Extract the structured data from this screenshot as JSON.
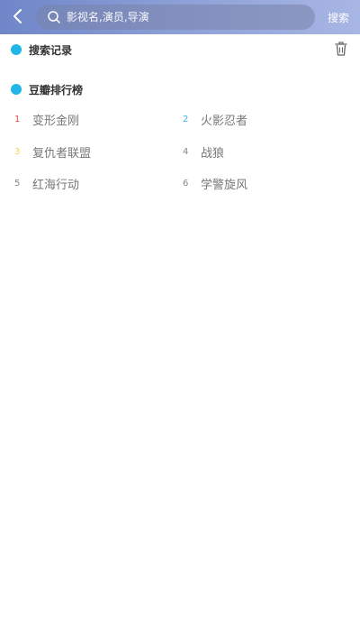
{
  "header": {
    "search_placeholder": "影视名,演员,导演",
    "search_button_label": "搜索"
  },
  "history": {
    "title": "搜索记录"
  },
  "ranking": {
    "title": "豆瓣排行榜",
    "items": [
      {
        "rank": "1",
        "title": "变形金刚",
        "color": "#e84a4a"
      },
      {
        "rank": "2",
        "title": "火影忍者",
        "color": "#3bb4e8"
      },
      {
        "rank": "3",
        "title": "复仇者联盟",
        "color": "#f3d64b"
      },
      {
        "rank": "4",
        "title": "战狼",
        "color": "#888888"
      },
      {
        "rank": "5",
        "title": "红海行动",
        "color": "#888888"
      },
      {
        "rank": "6",
        "title": "学警旋风",
        "color": "#888888"
      }
    ]
  },
  "colors": {
    "accent": "#20b6e8"
  }
}
